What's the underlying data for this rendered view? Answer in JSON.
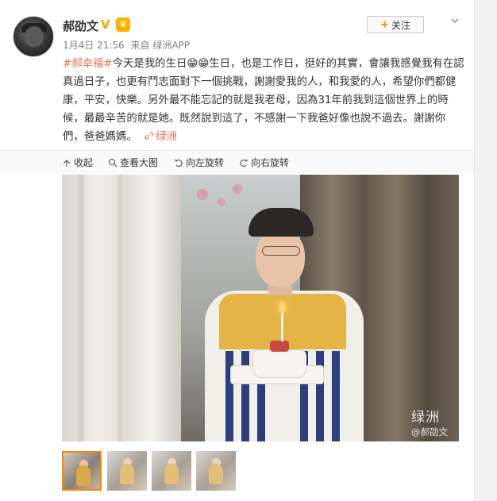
{
  "post": {
    "author": "郝劭文",
    "time": "1月4日 21:56",
    "source": "来自 绿洲APP",
    "follow_label": "关注",
    "hashtag": "#郝幸福#",
    "text": "今天是我的生日😁😁生日，也是工作日，挺好的其實，會讓我感覺我有在認真過日子，也更有鬥志面對下一個挑戰，謝謝愛我的人，和我愛的人，希望你們都健康，平安，快樂。另外最不能忘記的就是我老母，因為31年前我到這個世界上的時候，最最辛苦的就是她。既然說到這了，不感謝一下我爸好像也說不過去。謝謝你們，爸爸媽媽。",
    "location": "绿洲",
    "verified_badge": "V"
  },
  "toolbar": {
    "collapse": "收起",
    "view_large": "查看大图",
    "rotate_left": "向左旋转",
    "rotate_right": "向右旋转"
  },
  "photo": {
    "watermark_brand": "绿洲",
    "watermark_user": "@郝劭文"
  },
  "thumbnails": {
    "count": 4,
    "selected_index": 0
  },
  "colors": {
    "accent": "#eb7350",
    "follow_plus": "#ff8200",
    "vip_badge": "#ffb300",
    "verified": "#f7a600"
  },
  "icons": [
    "avatar",
    "verified-icon",
    "vip-crown-icon",
    "chevron-down-icon",
    "collapse-icon",
    "zoom-icon",
    "rotate-left-icon",
    "rotate-right-icon",
    "link-icon"
  ]
}
